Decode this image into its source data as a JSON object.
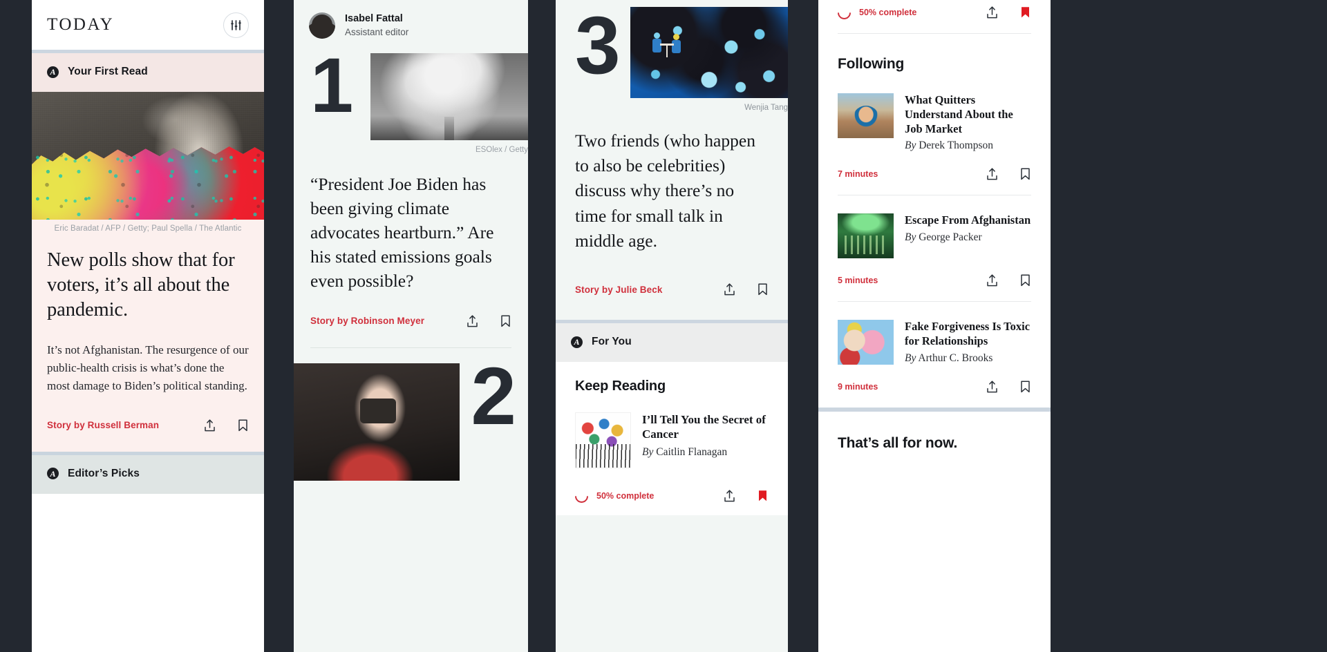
{
  "panel1": {
    "wordmark": "TODAY",
    "settings_icon": "sliders-icon",
    "section": {
      "label": "Your First Read",
      "mark": "A"
    },
    "hero_credit": "Eric Baradat / AFP / Getty; Paul Spella / The Atlantic",
    "headline": "New polls show that for voters, it’s all about the pandemic.",
    "dek": "It’s not Afghanistan. The resurgence of our public-health crisis is what’s done the most damage to Biden’s political standing.",
    "byline": "Story by Russell Berman",
    "share_icon": "share-icon",
    "bookmark_icon": "bookmark-icon",
    "next_section": {
      "label": "Editor’s Picks",
      "mark": "A"
    }
  },
  "panel2": {
    "author": {
      "name": "Isabel Fattal",
      "role": "Assistant editor",
      "avatar": "avatar"
    },
    "item_number": "1",
    "image_credit": "ESOlex / Getty",
    "quote": "“President Joe Biden has been giving climate advocates heartburn.” Are his stated emissions goals even possible?",
    "byline": "Story by Robinson Meyer",
    "share_icon": "share-icon",
    "bookmark_icon": "bookmark-icon",
    "next_item_number": "2"
  },
  "panel3": {
    "item_number": "3",
    "art_credit": "Wenjia Tang",
    "quote": "Two friends (who happen to also be celebrities) discuss why there’s no time for small talk in middle age.",
    "byline": "Story by Julie Beck",
    "share_icon": "share-icon",
    "bookmark_icon": "bookmark-icon",
    "section": {
      "label": "For You",
      "mark": "A"
    },
    "keep_reading_title": "Keep Reading",
    "card": {
      "title": "I’ll Tell You the Secret of Cancer",
      "by_prefix": "By",
      "author": "Caitlin Flanagan",
      "progress_text": "50% complete",
      "progress_percent": 50,
      "share_icon": "share-icon",
      "bookmark_icon": "bookmark-filled-icon"
    }
  },
  "panel4": {
    "top_progress": {
      "text": "50% complete",
      "percent": 50,
      "share_icon": "share-icon",
      "bookmark_icon": "bookmark-filled-icon"
    },
    "following_title": "Following",
    "items": [
      {
        "title": "What Quitters Understand About the Job Market",
        "by_prefix": "By",
        "author": "Derek Thompson",
        "minutes": "7 minutes",
        "share_icon": "share-icon",
        "bookmark_icon": "bookmark-icon",
        "thumb": "quitters-thumb"
      },
      {
        "title": "Escape From Afghanistan",
        "by_prefix": "By",
        "author": "George Packer",
        "minutes": "5 minutes",
        "share_icon": "share-icon",
        "bookmark_icon": "bookmark-icon",
        "thumb": "afghanistan-thumb"
      },
      {
        "title": "Fake Forgiveness Is Toxic for Relationships",
        "by_prefix": "By",
        "author": "Arthur C. Brooks",
        "minutes": "9 minutes",
        "share_icon": "share-icon",
        "bookmark_icon": "bookmark-icon",
        "thumb": "forgiveness-thumb"
      }
    ],
    "footer_title": "That’s all for now."
  },
  "colors": {
    "accent_red": "#d0303c",
    "dark": "#232830",
    "pink_bg": "#fcf0ee",
    "mint_bg": "#f2f6f4",
    "band_blue": "#ccd6e0"
  }
}
